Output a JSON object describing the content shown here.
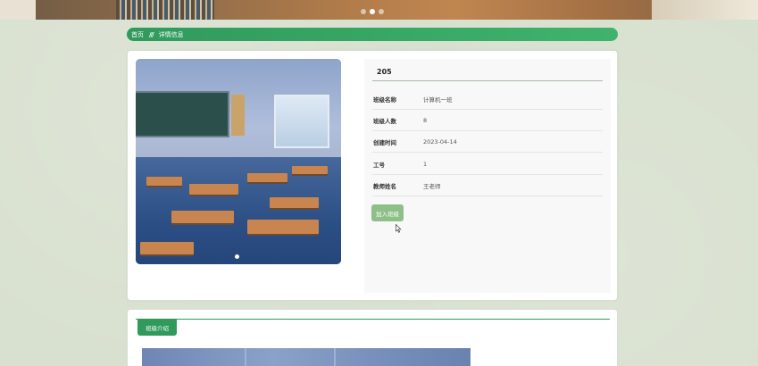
{
  "breadcrumb": {
    "home": "首页",
    "separator": "///",
    "current": "详情信息"
  },
  "detail": {
    "title": "205",
    "rows": [
      {
        "label": "班级名称",
        "value": "计算机一班"
      },
      {
        "label": "班级人数",
        "value": "8"
      },
      {
        "label": "创建时间",
        "value": "2023-04-14"
      },
      {
        "label": "工号",
        "value": "1"
      },
      {
        "label": "教师姓名",
        "value": "王老师"
      }
    ],
    "join_button": "加入班级"
  },
  "intro": {
    "tab_label": "班级介绍"
  },
  "colors": {
    "accent": "#2f9a5c",
    "button": "#8ebf88"
  }
}
